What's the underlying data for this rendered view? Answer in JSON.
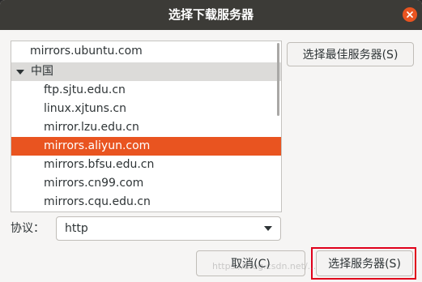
{
  "window": {
    "title": "选择下载服务器"
  },
  "servers": {
    "top_item": "mirrors.ubuntu.com",
    "group": {
      "label": "中国",
      "expanded": true
    },
    "items": [
      {
        "label": "ftp.sjtu.edu.cn",
        "selected": false
      },
      {
        "label": "linux.xjtuns.cn",
        "selected": false
      },
      {
        "label": "mirror.lzu.edu.cn",
        "selected": false
      },
      {
        "label": "mirrors.aliyun.com",
        "selected": true
      },
      {
        "label": "mirrors.bfsu.edu.cn",
        "selected": false
      },
      {
        "label": "mirrors.cn99.com",
        "selected": false
      },
      {
        "label": "mirrors.cqu.edu.cn",
        "selected": false
      }
    ]
  },
  "buttons": {
    "select_best": "选择最佳服务器(S)",
    "cancel": "取消(C)",
    "choose": "选择服务器(S)"
  },
  "protocol": {
    "label": "协议：",
    "value": "http"
  },
  "watermark": "https://blog.csdn.net/...",
  "colors": {
    "accent": "#e95420",
    "titlebar": "#3c3b37",
    "highlight_box": "#e0001b"
  },
  "icons": {
    "close": "close-icon",
    "expand": "triangle-down-icon",
    "dropdown": "chevron-down-icon"
  }
}
